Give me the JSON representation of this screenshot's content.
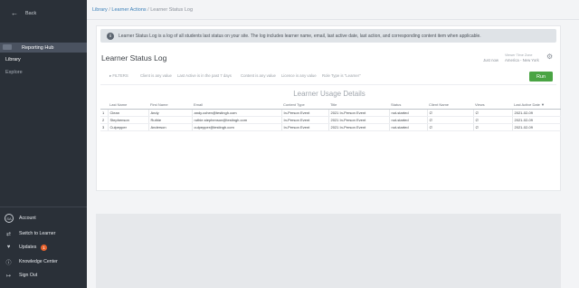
{
  "sidebar": {
    "back_label": "Back",
    "hub_label": "Reporting Hub",
    "nav": [
      {
        "label": "Library"
      },
      {
        "label": "Explore"
      }
    ],
    "bottom": {
      "account_initials": "SA",
      "account_label": "Account",
      "switch_label": "Switch to Learner",
      "updates_label": "Updates",
      "updates_count": "1",
      "knowledge_label": "Knowledge Center",
      "signout_label": "Sign Out"
    }
  },
  "breadcrumb": {
    "library": "Library",
    "actions": "Learner Actions",
    "current": "Learner Status Log",
    "sep": "/"
  },
  "report": {
    "info_text": "Learner Status Log is a log of all students last status on your site. The log includes learner name, email, last active date, last action, and corresponding content item when applicable.",
    "title": "Learner Status Log",
    "refreshed": "Just now",
    "tz_label": "Viewer Time Zone",
    "tz_value": "America - New York",
    "filters_label": "FILTERS",
    "filters": [
      "Client is any value",
      "Last Active is in the past 7 days",
      "Content is any value",
      "Licence is any value",
      "Role Type is \"Learner\""
    ],
    "run_label": "Run",
    "table_title": "Learner Usage Details",
    "columns": [
      "",
      "Last Name",
      "First Name",
      "Email",
      "Content Type",
      "Title",
      "Status",
      "Client Name",
      "Views",
      "Last Active Date"
    ],
    "sort_indicator": "▼",
    "rows": [
      {
        "n": "1",
        "last": "Clean",
        "first": "Andy",
        "email": "andy.cohen@testingh.com",
        "type": "In-Person Event",
        "title": "2021 In-Person Event",
        "status": "not-started",
        "client": "∅",
        "views": "∅",
        "date": "2021-02-09"
      },
      {
        "n": "2",
        "last": "Stephenson",
        "first": "Ruthie",
        "email": "ruthie.stephenson@testingh.com",
        "type": "In-Person Event",
        "title": "2021 In-Person Event",
        "status": "not-started",
        "client": "∅",
        "views": "∅",
        "date": "2021-02-09"
      },
      {
        "n": "3",
        "last": "Culpepper",
        "first": "Anderson",
        "email": "culpepper@testingh.com",
        "type": "In-Person Event",
        "title": "2021 In-Person Event",
        "status": "not-started",
        "client": "∅",
        "views": "∅",
        "date": "2021-02-09"
      }
    ]
  }
}
